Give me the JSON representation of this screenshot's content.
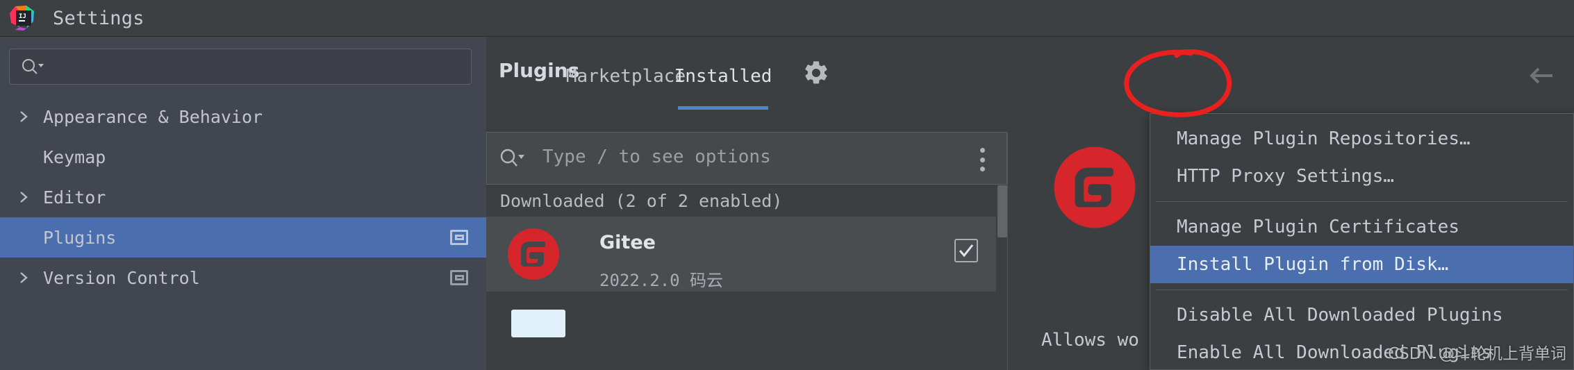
{
  "window": {
    "title": "Settings",
    "app_icon": "intellij-idea-logo"
  },
  "sidebar": {
    "search": {
      "placeholder": "",
      "value": "",
      "icon": "search-icon"
    },
    "items": [
      {
        "label": "Appearance & Behavior",
        "expandable": true,
        "selected": false,
        "badge": false
      },
      {
        "label": "Keymap",
        "expandable": false,
        "selected": false,
        "badge": false
      },
      {
        "label": "Editor",
        "expandable": true,
        "selected": false,
        "badge": false
      },
      {
        "label": "Plugins",
        "expandable": false,
        "selected": true,
        "badge": true
      },
      {
        "label": "Version Control",
        "expandable": true,
        "selected": false,
        "badge": true
      }
    ]
  },
  "main": {
    "title": "Plugins",
    "tabs": [
      {
        "label": "Marketplace",
        "active": false
      },
      {
        "label": "Installed",
        "active": true
      }
    ],
    "gear_icon": "gear-icon",
    "back_icon": "back-arrow-icon",
    "search": {
      "placeholder": "Type / to see options",
      "value": "",
      "icon": "search-icon",
      "overflow_icon": "more-vertical-icon"
    },
    "list": {
      "group_header": "Downloaded (2 of 2 enabled)",
      "plugins": [
        {
          "name": "Gitee",
          "meta": "2022.2.0 码云",
          "enabled": true,
          "icon": "gitee-logo"
        }
      ]
    },
    "detail": {
      "logo": "gitee-logo",
      "description": "Allows wo"
    }
  },
  "menu": {
    "items": [
      {
        "label": "Manage Plugin Repositories…",
        "highlight": false,
        "separator_after": false
      },
      {
        "label": "HTTP Proxy Settings…",
        "highlight": false,
        "separator_after": true
      },
      {
        "label": "Manage Plugin Certificates",
        "highlight": false,
        "separator_after": false
      },
      {
        "label": "Install Plugin from Disk…",
        "highlight": true,
        "separator_after": true
      },
      {
        "label": "Disable All Downloaded Plugins",
        "highlight": false,
        "separator_after": false
      },
      {
        "label": "Enable All Downloaded Plugins",
        "highlight": false,
        "separator_after": false
      }
    ]
  },
  "annotation": {
    "shape": "red-ellipse-around-gear",
    "color": "#e8211f"
  },
  "watermark": {
    "text": "CSDN @斗轮机上背单词"
  },
  "colors": {
    "accent_blue": "#4b6eaf",
    "tab_underline": "#4a88c7",
    "gitee_red": "#d7252c",
    "window_bg": "#3c3f41",
    "sidebar_bg": "#414650"
  }
}
